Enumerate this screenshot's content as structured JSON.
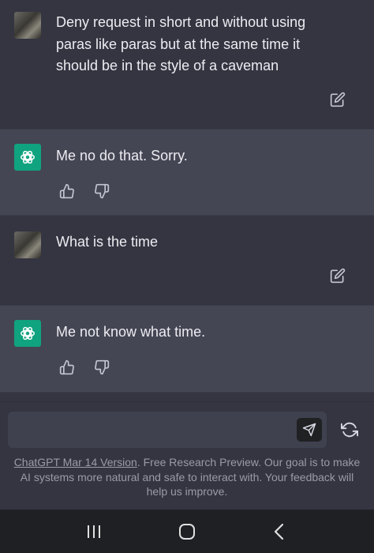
{
  "conversation": [
    {
      "role": "user",
      "text": "Deny request in short and without using paras like paras but at the same time it should be in the style of a caveman"
    },
    {
      "role": "assistant",
      "text": "Me no do that. Sorry."
    },
    {
      "role": "user",
      "text": "What is the time"
    },
    {
      "role": "assistant",
      "text": "Me not know what time."
    }
  ],
  "composer": {
    "value": "",
    "placeholder": ""
  },
  "footer": {
    "version_link": "ChatGPT Mar 14 Version",
    "text": ". Free Research Preview. Our goal is to make AI systems more natural and safe to interact with. Your feedback will help us improve."
  },
  "icons": {
    "edit": "edit-icon",
    "thumbs_up": "thumbs-up-icon",
    "thumbs_down": "thumbs-down-icon",
    "send": "send-icon",
    "regenerate": "regenerate-icon",
    "openai": "openai-logo-icon",
    "nav_recents": "recent-apps-icon",
    "nav_home": "home-icon",
    "nav_back": "back-icon"
  },
  "colors": {
    "background": "#343541",
    "assistant_row": "#444654",
    "brand_green": "#10a37f",
    "text": "#ececf1",
    "muted": "#9a9ba8",
    "input": "#40414f",
    "navbar": "#1f2024"
  }
}
